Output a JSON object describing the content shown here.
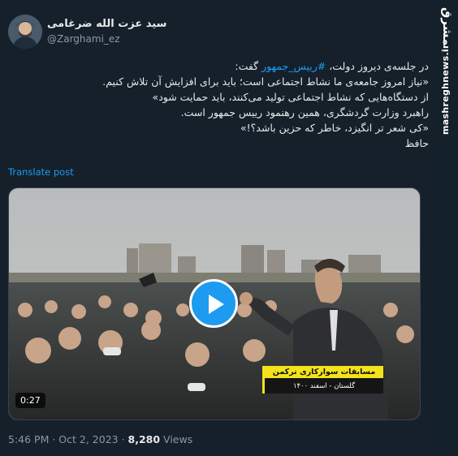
{
  "author": {
    "display_name": "سید عزت الله ضرغامی",
    "handle": "@Zarghami_ez"
  },
  "tweet": {
    "line1_prefix": "در جلسه‌ی دیروز دولت، ",
    "line1_hashtag": "#رییس_جمهور",
    "line1_suffix": " گفت:",
    "line2": "«نیاز امروز جامعه‌ی ما نشاط اجتماعی است؛ باید برای افزایش آن تلاش کنیم.",
    "line3": "از دستگاه‌هایی که نشاط اجتماعی تولید می‌کنند، باید حمایت شود»",
    "line4": "راهبرد وزارت گردشگری، همین رهنمود رییس جمهور است.",
    "line5": "«کی شعر تر انگیزد، خاطر که حزین باشد؟!»",
    "line6": "حافظ",
    "translate_label": "Translate post"
  },
  "video": {
    "duration": "0:27",
    "caption_title": "مسابقات سوارکاری ترکمن",
    "caption_sub": "گلستان - اسفند ۱۴۰۰"
  },
  "meta": {
    "time": "5:46 PM",
    "separator": " · ",
    "date": "Oct 2, 2023",
    "views_count": "8,280",
    "views_label": " Views"
  },
  "watermark": {
    "logo": "مشرق",
    "site": "mashreghnews.ir"
  },
  "colors": {
    "background": "#15202b",
    "accent": "#1d9bf0",
    "secondary_text": "#8b98a5",
    "caption_yellow": "#f4e31a"
  }
}
